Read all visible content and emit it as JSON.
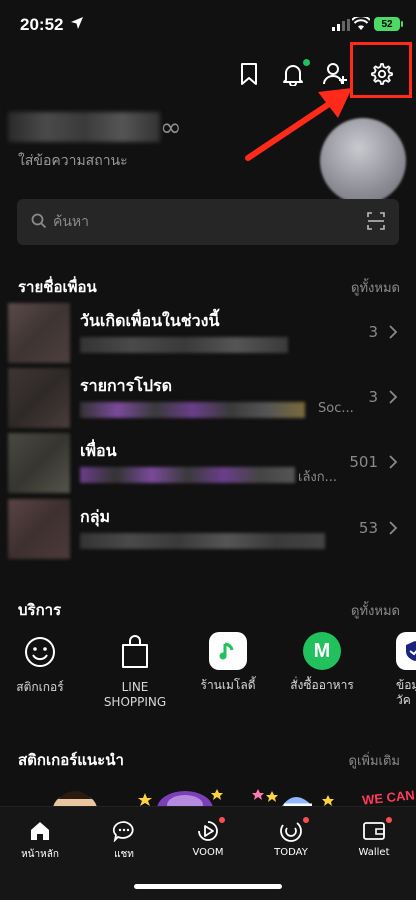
{
  "status_bar": {
    "time": "20:52",
    "battery": "52"
  },
  "profile": {
    "status_message": "ใส่ข้อความสถานะ",
    "suffix_symbol": "∞"
  },
  "search": {
    "placeholder": "ค้นหา"
  },
  "friends_section": {
    "title": "รายชื่อเพื่อน",
    "see_all": "ดูทั้งหมด",
    "rows": [
      {
        "title": "วันเกิดเพื่อนในช่วงนี้",
        "count": "3",
        "sub_tail": ""
      },
      {
        "title": "รายการโปรด",
        "count": "3",
        "sub_tail": "Soc..."
      },
      {
        "title": "เพื่อน",
        "count": "501",
        "sub_tail": "เล้งก..."
      },
      {
        "title": "กลุ่ม",
        "count": "53",
        "sub_tail": ""
      }
    ]
  },
  "services_section": {
    "title": "บริการ",
    "see_all": "ดูทั้งหมด",
    "items": [
      {
        "label": "สติกเกอร์",
        "icon": "smiley-icon"
      },
      {
        "label": "LINE\nSHOPPING",
        "icon": "shopping-bag-icon"
      },
      {
        "label": "ร้านเมโลดี้",
        "icon": "music-note-icon"
      },
      {
        "label": "สั่งซื้ออาหาร",
        "icon": "line-man-icon"
      },
      {
        "label": "ข้อมู\nวัค",
        "icon": "shield-icon"
      }
    ]
  },
  "stickers_section": {
    "title": "สติกเกอร์แนะนำ",
    "see_more": "ดูเพิ่มเติม",
    "sticker_text": "WE CAN"
  },
  "bottom_nav": {
    "tabs": [
      {
        "label": "หน้าหลัก",
        "icon": "home-icon"
      },
      {
        "label": "แชท",
        "icon": "chat-icon"
      },
      {
        "label": "VOOM",
        "icon": "voom-icon"
      },
      {
        "label": "TODAY",
        "icon": "today-icon"
      },
      {
        "label": "Wallet",
        "icon": "wallet-icon"
      }
    ]
  },
  "colors": {
    "background": "#111111",
    "accent_green": "#21c15e",
    "highlight_red": "#ff2a1a",
    "notification_red": "#ff4d4d"
  }
}
